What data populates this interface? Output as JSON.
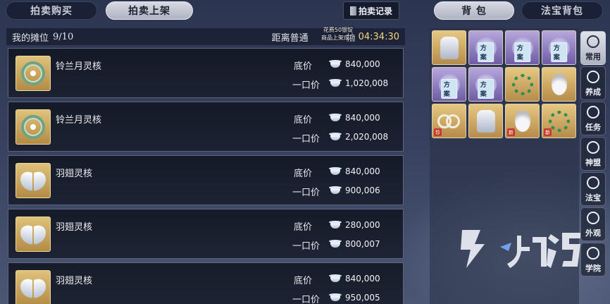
{
  "tabs": {
    "buy": "拍卖购买",
    "sell": "拍卖上架",
    "bag": "背 包",
    "treasure_bag": "法宝背包"
  },
  "record_button": "拍卖记录",
  "stall": {
    "label": "我的摊位",
    "count": "9/10",
    "countdown_label": "距离普通",
    "countdown_label_tail": "拍",
    "countdown": "04:34:30"
  },
  "toast": {
    "line1": "花费50银锭",
    "line2": "商品上架成功"
  },
  "labels": {
    "base_price": "底价",
    "buyout_price": "一口价"
  },
  "listings": [
    {
      "name": "铃兰月灵核",
      "icon": "wreath-icon",
      "base_price": "840,000",
      "buyout_price": "1,020,008"
    },
    {
      "name": "铃兰月灵核",
      "icon": "wreath-icon",
      "base_price": "840,000",
      "buyout_price": "2,020,008"
    },
    {
      "name": "羽翅灵核",
      "icon": "wings-icon",
      "base_price": "840,000",
      "buyout_price": "900,006"
    },
    {
      "name": "羽翅灵核",
      "icon": "wings-icon",
      "base_price": "280,000",
      "buyout_price": "800,007"
    },
    {
      "name": "羽翅灵核",
      "icon": "wings-icon",
      "base_price": "840,000",
      "buyout_price": "950,005"
    }
  ],
  "inventory": [
    {
      "icon": "robe-icon",
      "frame": "gold",
      "badge": ""
    },
    {
      "icon": "armor-icon",
      "frame": "purple",
      "badge": "方案"
    },
    {
      "icon": "armor-icon",
      "frame": "purple",
      "badge": "方案"
    },
    {
      "icon": "armor-icon",
      "frame": "purple",
      "badge": "方案"
    },
    {
      "icon": "armor-icon",
      "frame": "purple",
      "badge": "方案"
    },
    {
      "icon": "armor-icon",
      "frame": "purple",
      "badge": "方案"
    },
    {
      "icon": "beads-icon",
      "frame": "gold",
      "badge": ""
    },
    {
      "icon": "gourd-icon",
      "frame": "gold",
      "badge": ""
    },
    {
      "icon": "rings-icon",
      "frame": "gold",
      "badge": "",
      "mark": "珍"
    },
    {
      "icon": "robe-icon",
      "frame": "gold",
      "badge": ""
    },
    {
      "icon": "gourd-icon",
      "frame": "gold",
      "badge": "",
      "mark": "新"
    },
    {
      "icon": "beads-icon",
      "frame": "gold",
      "badge": "",
      "mark": "新"
    }
  ],
  "side_nav": [
    "常用",
    "养成",
    "任务",
    "神盟",
    "法宝",
    "外观",
    "学院"
  ],
  "colors": {
    "countdown": "#f2d583",
    "item_frame_gold": "#d4b06a",
    "item_frame_purple": "#8d7cc4",
    "new_mark": "#c63a2e"
  }
}
